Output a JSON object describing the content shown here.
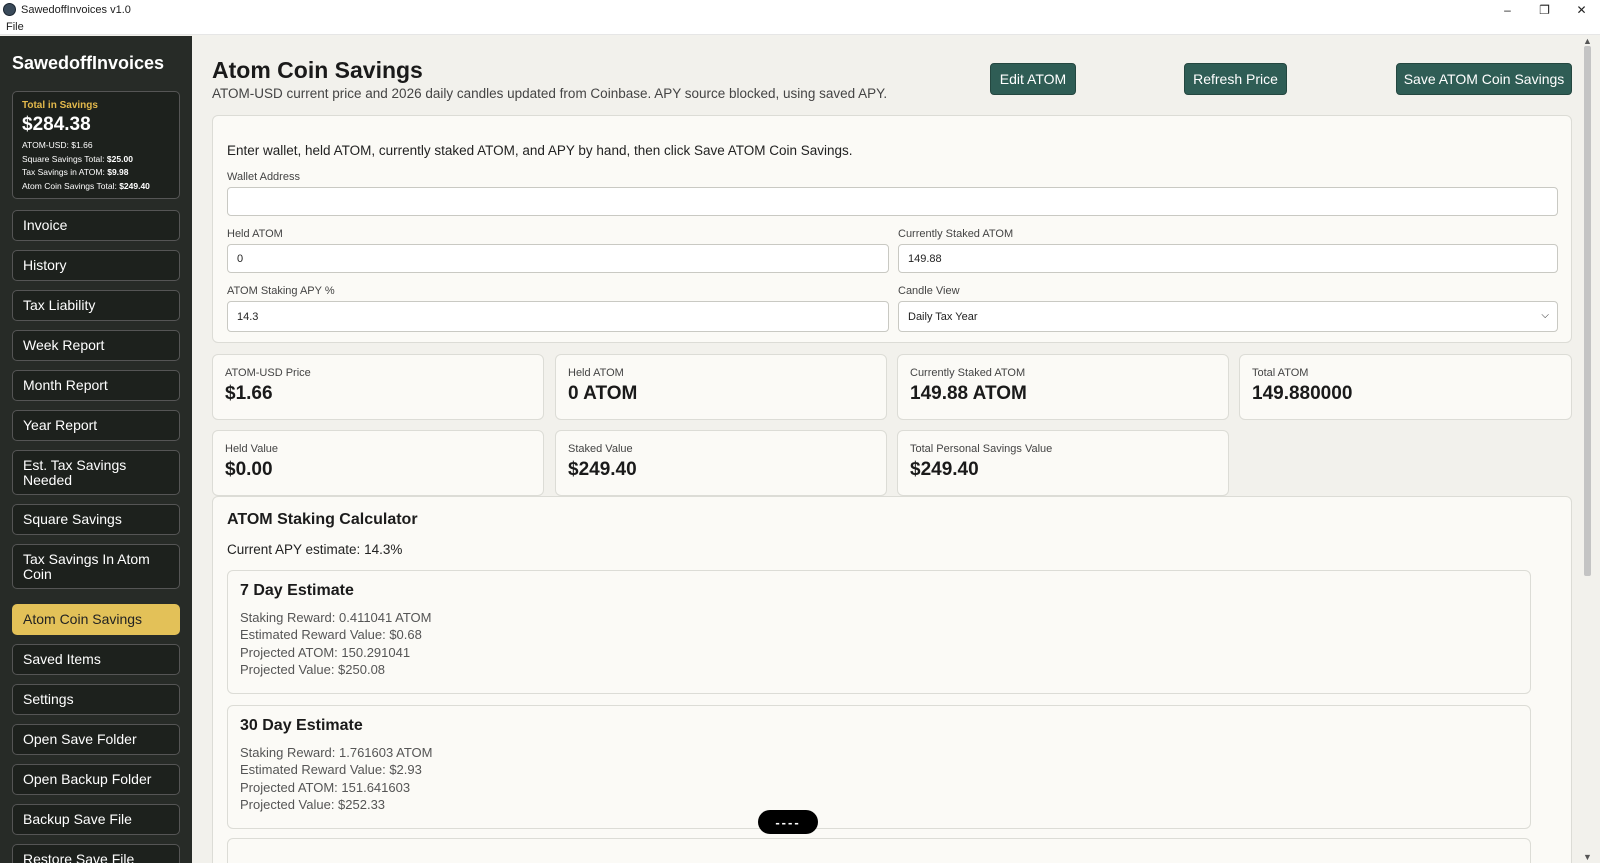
{
  "window": {
    "title": "SawedoffInvoices v1.0",
    "minimize": "–",
    "maximize": "❐",
    "close": "✕"
  },
  "menu": {
    "file": "File"
  },
  "sidebar": {
    "brand": "SawedoffInvoices",
    "summary": {
      "label": "Total in Savings",
      "amount": "$284.38",
      "atom_usd": "ATOM-USD: $1.66",
      "square_label": "Square Savings Total:",
      "square_value": "$25.00",
      "tax_label": "Tax Savings in ATOM:",
      "tax_value": "$9.98",
      "atom_label": "Atom Coin Savings Total:",
      "atom_value": "$249.40"
    },
    "items": [
      {
        "label": "Invoice"
      },
      {
        "label": "History"
      },
      {
        "label": "Tax Liability"
      },
      {
        "label": "Week Report"
      },
      {
        "label": "Month Report"
      },
      {
        "label": "Year Report"
      },
      {
        "label": "Est. Tax Savings Needed"
      },
      {
        "label": "Square Savings"
      },
      {
        "label": "Tax Savings In Atom Coin"
      },
      {
        "label": "Atom Coin Savings"
      },
      {
        "label": "Saved Items"
      },
      {
        "label": "Settings"
      },
      {
        "label": "Open Save Folder"
      },
      {
        "label": "Open Backup Folder"
      },
      {
        "label": "Backup Save File"
      },
      {
        "label": "Restore Save File"
      }
    ],
    "active_item": "Atom Coin Savings"
  },
  "header": {
    "title": "Atom Coin Savings",
    "subtitle": "ATOM-USD current price and 2026 daily candles updated from Coinbase. APY source blocked, using saved APY.",
    "edit_label": "Edit ATOM",
    "refresh_label": "Refresh Price",
    "save_label": "Save ATOM Coin Savings"
  },
  "form": {
    "intro": "Enter wallet, held ATOM, currently staked ATOM, and APY by hand, then click Save ATOM Coin Savings.",
    "wallet_label": "Wallet Address",
    "wallet_value": "",
    "held_label": "Held ATOM",
    "held_value": "0",
    "staked_label": "Currently Staked ATOM",
    "staked_value": "149.88",
    "apy_label": "ATOM Staking APY %",
    "apy_value": "14.3",
    "candle_label": "Candle View",
    "candle_value": "Daily Tax Year"
  },
  "stats": {
    "price_label": "ATOM-USD Price",
    "price_value": "$1.66",
    "held_label": "Held ATOM",
    "held_value": "0 ATOM",
    "staked_label": "Currently Staked ATOM",
    "staked_value": "149.88 ATOM",
    "total_label": "Total ATOM",
    "total_value": "149.880000",
    "held_val_label": "Held Value",
    "held_val_value": "$0.00",
    "staked_val_label": "Staked Value",
    "staked_val_value": "$249.40",
    "personal_label": "Total Personal Savings Value",
    "personal_value": "$249.40"
  },
  "calculator": {
    "title": "ATOM Staking Calculator",
    "apy_text": "Current APY estimate: 14.3%",
    "estimates": [
      {
        "title": "7 Day Estimate",
        "reward": "Staking Reward: 0.411041 ATOM",
        "reward_value": "Estimated Reward Value: $0.68",
        "projected_atom": "Projected ATOM: 150.291041",
        "projected_value": "Projected Value: $250.08"
      },
      {
        "title": "30 Day Estimate",
        "reward": "Staking Reward: 1.761603 ATOM",
        "reward_value": "Estimated Reward Value: $2.93",
        "projected_atom": "Projected ATOM: 151.641603",
        "projected_value": "Projected Value: $252.33"
      }
    ]
  },
  "overlay": {
    "pill": "----"
  },
  "colors": {
    "sidebar_bg": "#272b27",
    "accent_gold": "#e3c158",
    "button_teal": "#2f5d55",
    "page_bg": "#f2f1ec"
  }
}
